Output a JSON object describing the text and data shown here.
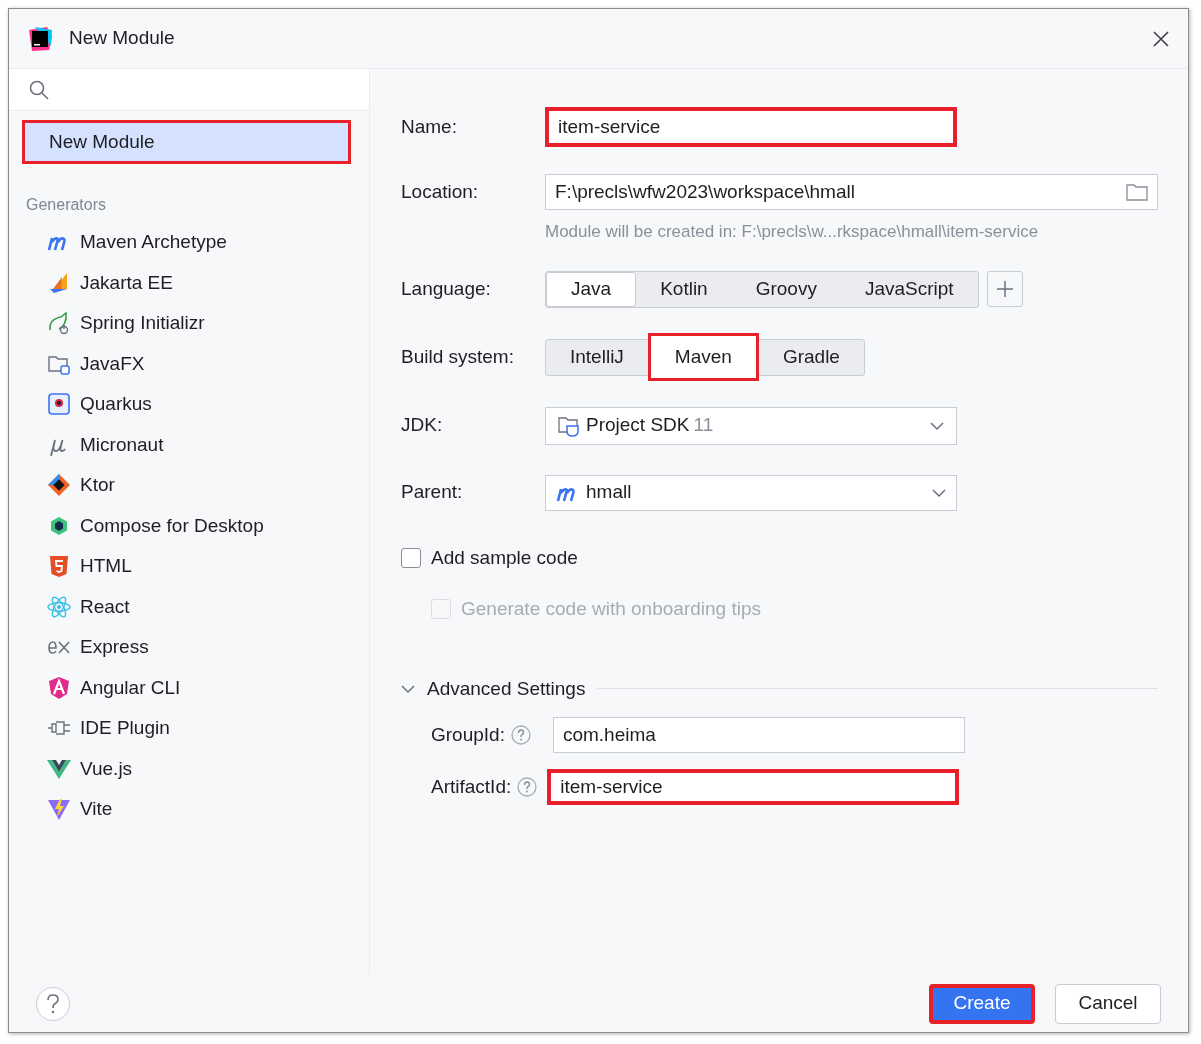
{
  "window": {
    "title": "New Module"
  },
  "sidebar": {
    "items": [
      {
        "label": "New Module",
        "selected": true,
        "highlighted": true
      }
    ],
    "section": "Generators",
    "generators": [
      {
        "label": "Maven Archetype",
        "selected": false
      },
      {
        "label": "Jakarta EE",
        "selected": false
      },
      {
        "label": "Spring Initializr",
        "selected": false
      },
      {
        "label": "JavaFX",
        "selected": false
      },
      {
        "label": "Quarkus",
        "selected": false
      },
      {
        "label": "Micronaut",
        "selected": false
      },
      {
        "label": "Ktor",
        "selected": false
      },
      {
        "label": "Compose for Desktop",
        "selected": false
      },
      {
        "label": "HTML",
        "selected": false
      },
      {
        "label": "React",
        "selected": false
      },
      {
        "label": "Express",
        "selected": false
      },
      {
        "label": "Angular CLI",
        "selected": false
      },
      {
        "label": "IDE Plugin",
        "selected": false
      },
      {
        "label": "Vue.js",
        "selected": false
      },
      {
        "label": "Vite",
        "selected": false
      }
    ]
  },
  "form": {
    "name": {
      "label": "Name:",
      "value": "item-service",
      "highlighted": true
    },
    "location": {
      "label": "Location:",
      "value": "F:\\precls\\wfw2023\\workspace\\hmall",
      "hint": "Module will be created in: F:\\precls\\w...rkspace\\hmall\\item-service"
    },
    "language": {
      "label": "Language:",
      "options": [
        {
          "label": "Java",
          "selected": true
        },
        {
          "label": "Kotlin",
          "selected": false
        },
        {
          "label": "Groovy",
          "selected": false
        },
        {
          "label": "JavaScript",
          "selected": false
        }
      ]
    },
    "build_system": {
      "label": "Build system:",
      "options": [
        {
          "label": "IntelliJ",
          "selected": false,
          "highlighted": false
        },
        {
          "label": "Maven",
          "selected": true,
          "highlighted": true
        },
        {
          "label": "Gradle",
          "selected": false,
          "highlighted": false
        }
      ]
    },
    "jdk": {
      "label": "JDK:",
      "value": "Project SDK",
      "version": "11"
    },
    "parent": {
      "label": "Parent:",
      "value": "hmall"
    },
    "add_sample_code": {
      "label": "Add sample code",
      "checked": false,
      "disabled": false
    },
    "onboarding_tips": {
      "label": "Generate code with onboarding tips",
      "checked": false,
      "disabled": true
    },
    "advanced": {
      "title": "Advanced Settings",
      "expanded": true,
      "fields": [
        {
          "label": "GroupId:",
          "value": "com.heima",
          "highlighted": false
        },
        {
          "label": "ArtifactId:",
          "value": "item-service",
          "highlighted": true
        }
      ]
    }
  },
  "buttons": [
    {
      "label": "Create",
      "kind": "primary",
      "highlighted": true
    },
    {
      "label": "Cancel",
      "kind": "secondary",
      "highlighted": false
    }
  ]
}
